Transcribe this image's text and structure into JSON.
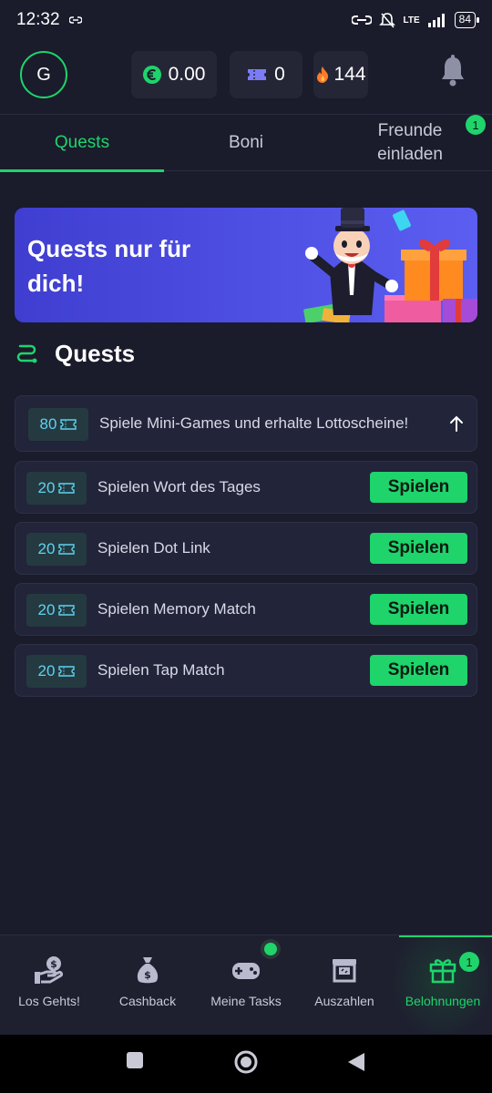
{
  "status": {
    "time": "12:32",
    "network": "LTE",
    "battery": "84"
  },
  "header": {
    "avatar_letter": "G",
    "balance": "0.00",
    "tickets": "0",
    "streak": "144",
    "icons": {
      "currency": "euro-icon",
      "ticket": "ticket-icon",
      "fire": "flame-icon",
      "bell": "bell-icon"
    }
  },
  "tabs": [
    {
      "label": "Quests",
      "active": true
    },
    {
      "label": "Boni",
      "active": false
    },
    {
      "label": "Freunde einladen",
      "active": false,
      "badge": "1"
    }
  ],
  "banner": {
    "title": "Quests nur für dich!"
  },
  "section": {
    "title": "Quests",
    "icon": "route-icon"
  },
  "quests": {
    "main": {
      "reward": "80",
      "label": "Spiele Mini-Games und erhalte Lottoscheine!"
    },
    "items": [
      {
        "reward": "20",
        "label": "Spielen Wort des Tages",
        "button": "Spielen"
      },
      {
        "reward": "20",
        "label": "Spielen Dot Link",
        "button": "Spielen"
      },
      {
        "reward": "20",
        "label": "Spielen Memory Match",
        "button": "Spielen"
      },
      {
        "reward": "20",
        "label": "Spielen Tap Match",
        "button": "Spielen"
      }
    ]
  },
  "nav": [
    {
      "label": "Los Gehts!",
      "icon": "hand-coin-icon"
    },
    {
      "label": "Cashback",
      "icon": "money-bag-icon"
    },
    {
      "label": "Meine Tasks",
      "icon": "gamepad-icon"
    },
    {
      "label": "Auszahlen",
      "icon": "cash-register-icon"
    },
    {
      "label": "Belohnungen",
      "icon": "gift-icon",
      "active": true,
      "badge": "1"
    }
  ],
  "colors": {
    "accent": "#1ed46b",
    "background": "#1a1b2b",
    "card": "#22243a",
    "banner": "#4a4be0"
  }
}
